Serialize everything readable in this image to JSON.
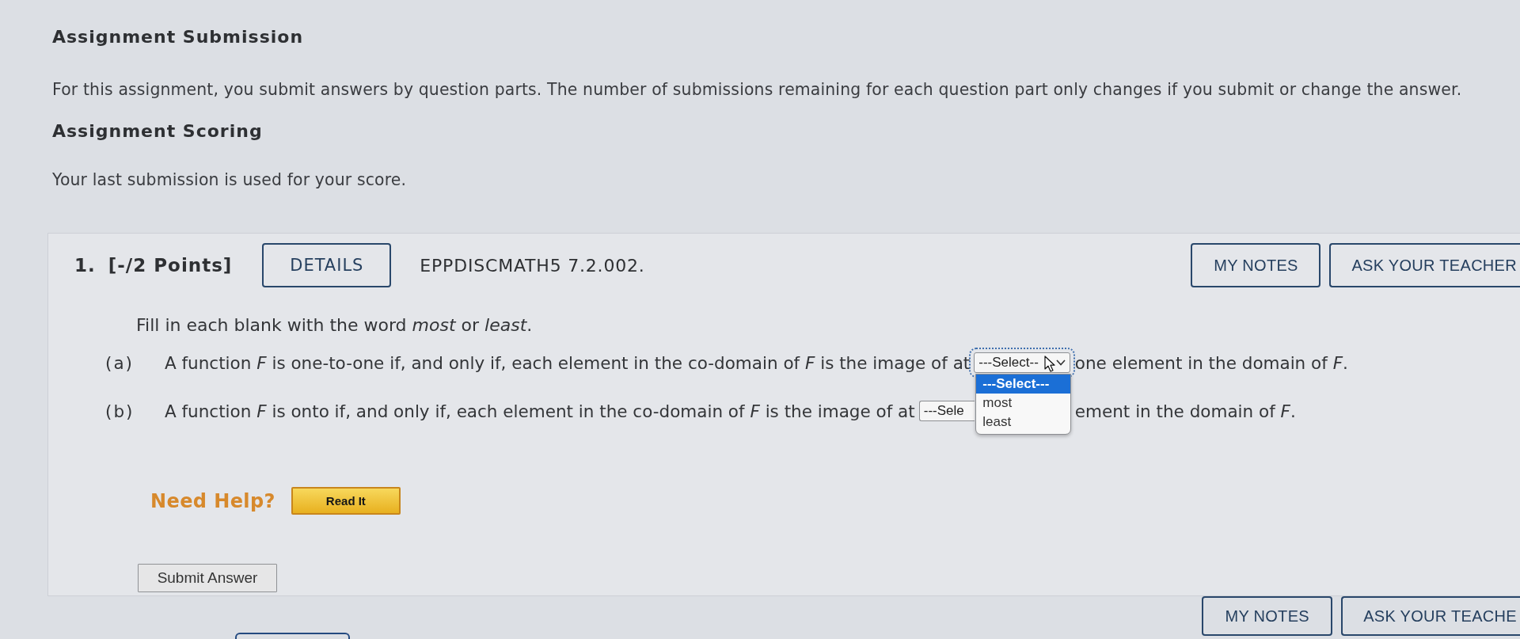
{
  "assignment_submission": {
    "heading": "Assignment Submission",
    "text": "For this assignment, you submit answers by question parts. The number of submissions remaining for each question part only changes if you submit or change the answer."
  },
  "assignment_scoring": {
    "heading": "Assignment Scoring",
    "text": "Your last submission is used for your score."
  },
  "question": {
    "number": "1.",
    "points": "[-/2 Points]",
    "details_button": "DETAILS",
    "code": "EPPDISCMATH5 7.2.002.",
    "header_buttons": [
      "MY NOTES",
      "ASK YOUR TEACHER"
    ],
    "instructions": "Fill in each blank with the word *most* or *least*.",
    "parts": [
      {
        "label": "(a)",
        "text_before": "A function *F* is one-to-one if, and only if, each element in the co-domain of *F* is the image of at",
        "blank": {
          "value": "---Select--",
          "expanded": true,
          "options": [
            {
              "label": "---Select---",
              "selected": true
            },
            {
              "label": "most",
              "selected": false
            },
            {
              "label": "least",
              "selected": false
            }
          ]
        },
        "text_after": "one element in the domain of *F*."
      },
      {
        "label": "(b)",
        "text_before": "A function *F* is onto if, and only if, each element in the co-domain of *F* is the image of at",
        "blank": {
          "value": "---Sele",
          "expanded": false
        },
        "text_after": "ement in the domain of *F*."
      }
    ],
    "help": {
      "label": "Need Help?",
      "buttons": [
        "Read It"
      ]
    },
    "submit_button": "Submit Answer"
  },
  "footer_buttons": [
    "MY NOTES",
    "ASK YOUR TEACHE"
  ]
}
